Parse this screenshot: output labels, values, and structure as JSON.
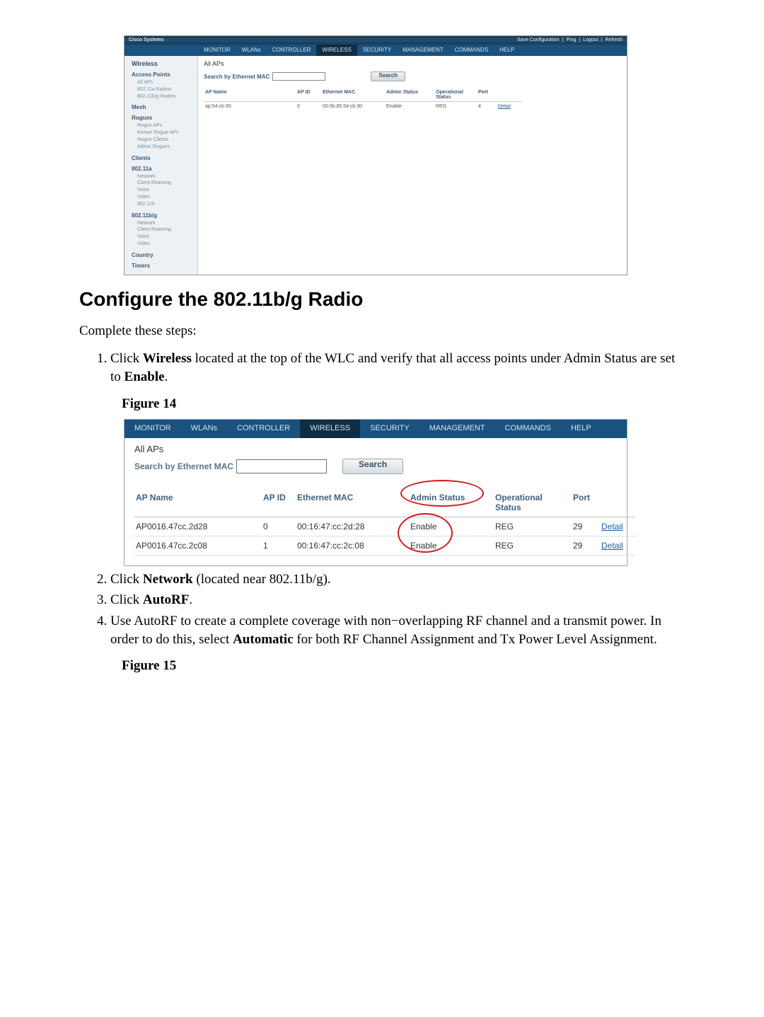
{
  "fig13": {
    "vendor": "Cisco Systems",
    "top_links": [
      "Save Configuration",
      "Ping",
      "Logout",
      "Refresh"
    ],
    "tabs": [
      "MONITOR",
      "WLANs",
      "CONTROLLER",
      "WIRELESS",
      "SECURITY",
      "MANAGEMENT",
      "COMMANDS",
      "HELP"
    ],
    "active_tab": 3,
    "sidebar_title": "Wireless",
    "sidebar": [
      {
        "cat": "Access Points",
        "subs": [
          "All APs",
          "802.11a Radios",
          "802.11b/g Radios"
        ]
      },
      {
        "cat": "Mesh",
        "subs": []
      },
      {
        "cat": "Rogues",
        "subs": [
          "Rogue APs",
          "Known Rogue APs",
          "Rogue Clients",
          "Adhoc Rogues"
        ]
      },
      {
        "cat": "Clients",
        "subs": []
      },
      {
        "cat": "802.11a",
        "subs": [
          "Network",
          "Client Roaming",
          "Voice",
          "Video",
          "802.11h"
        ]
      },
      {
        "cat": "802.11b/g",
        "subs": [
          "Network",
          "Client Roaming",
          "Voice",
          "Video"
        ]
      },
      {
        "cat": "Country",
        "subs": []
      },
      {
        "cat": "Timers",
        "subs": []
      }
    ],
    "main_title": "All APs",
    "search_label": "Search by Ethernet MAC",
    "search_button": "Search",
    "headers": [
      "AP Name",
      "AP ID",
      "Ethernet MAC",
      "Admin Status",
      "Operational Status",
      "Port",
      ""
    ],
    "rows": [
      {
        "name": "ap:54:cb:30",
        "id": "0",
        "mac": "00:0b:85:54:cb:30",
        "adm": "Enable",
        "op": "REG",
        "port": "4",
        "link": "Detail"
      }
    ]
  },
  "doc": {
    "h2": "Configure the 802.11b/g Radio",
    "intro": "Complete these steps:",
    "step1": {
      "prefix": "Click ",
      "b1": "Wireless",
      "mid": " located at the top of the WLC and verify that all access points under Admin Status are set to ",
      "b2": "Enable",
      "suffix": "."
    },
    "fig14cap": "Figure 14",
    "step2": {
      "prefix": "Click ",
      "b1": "Network",
      "suffix": " (located near 802.11b/g)."
    },
    "step3": {
      "prefix": "Click ",
      "b1": "AutoRF",
      "suffix": "."
    },
    "step4": {
      "prefix": "Use AutoRF to create a complete coverage with non−overlapping RF channel and a transmit power. In order to do this, select ",
      "b1": "Automatic",
      "suffix": " for both RF Channel Assignment and Tx Power Level Assignment."
    },
    "fig15cap": "Figure 15"
  },
  "fig14": {
    "tabs": [
      "MONITOR",
      "WLANs",
      "CONTROLLER",
      "WIRELESS",
      "SECURITY",
      "MANAGEMENT",
      "COMMANDS",
      "HELP"
    ],
    "active_tab": 3,
    "main_title": "All APs",
    "search_label": "Search by Ethernet MAC",
    "search_button": "Search",
    "headers": [
      "AP Name",
      "AP ID",
      "Ethernet MAC",
      "Admin Status",
      "Operational Status",
      "Port",
      ""
    ],
    "rows": [
      {
        "name": "AP0016.47cc.2d28",
        "id": "0",
        "mac": "00:16:47:cc:2d:28",
        "adm": "Enable",
        "op": "REG",
        "port": "29",
        "link": "Detail"
      },
      {
        "name": "AP0016.47cc.2c08",
        "id": "1",
        "mac": "00:16:47:cc:2c:08",
        "adm": "Enable",
        "op": "REG",
        "port": "29",
        "link": "Detail"
      }
    ]
  },
  "chart_data": {
    "type": "table",
    "title": "All APs (Figure 14)",
    "columns": [
      "AP Name",
      "AP ID",
      "Ethernet MAC",
      "Admin Status",
      "Operational Status",
      "Port"
    ],
    "rows": [
      [
        "AP0016.47cc.2d28",
        0,
        "00:16:47:cc:2d:28",
        "Enable",
        "REG",
        29
      ],
      [
        "AP0016.47cc.2c08",
        1,
        "00:16:47:cc:2c:08",
        "Enable",
        "REG",
        29
      ]
    ]
  }
}
